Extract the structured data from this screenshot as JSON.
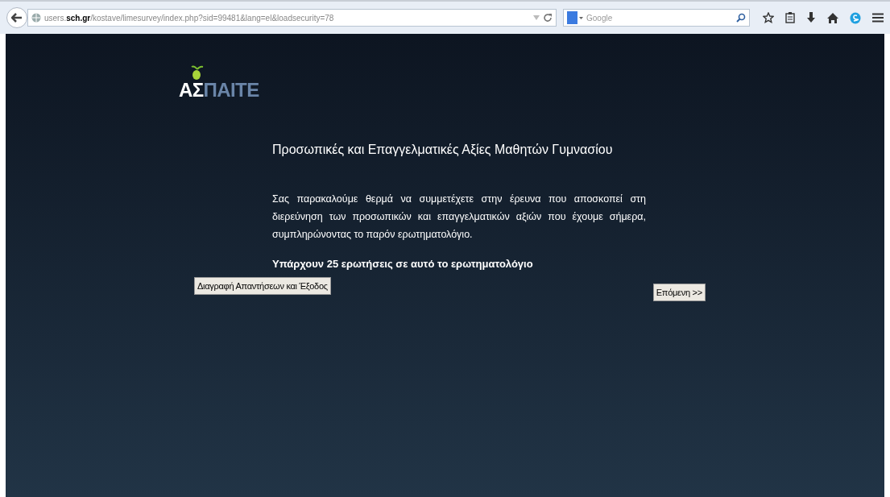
{
  "browser": {
    "url_host_prefix": "users.",
    "url_host_domain": "sch.gr",
    "url_path": "/kostave/limesurvey/index.php?sid=99481&lang=el&loadsecurity=78",
    "search_placeholder": "Google"
  },
  "logo": {
    "part_1": "ΑΣ",
    "part_2": "ΠΑΙΤΕ"
  },
  "survey": {
    "title": "Προσωπικές και Επαγγελματικές Αξίες Μαθητών Γυμνασίου",
    "description": "Σας παρακαλούμε θερμά να συμμετέχετε στην έρευνα που αποσκοπεί στη διερεύνηση των προσωπικών και επαγγελματικών αξιών που έχουμε σήμερα, συμπληρώνοντας το παρόν ερωτηματολόγιο.",
    "question_count": "Υπάρχουν 25 ερωτήσεις σε αυτό το ερωτηματολόγιο"
  },
  "buttons": {
    "clear_exit": "Διαγραφή Απαντήσεων και Έξοδος",
    "next": "Επόμενη >>"
  }
}
